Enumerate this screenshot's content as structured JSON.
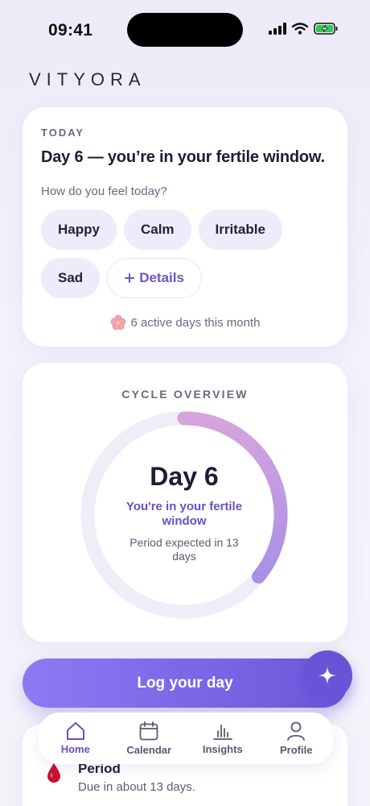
{
  "status_bar": {
    "time": "09:41"
  },
  "brand": "VITYORA",
  "today": {
    "eyebrow": "TODAY",
    "headline": "Day 6 — you’re in your fertile window.",
    "prompt": "How do you feel today?",
    "moods": [
      "Happy",
      "Calm",
      "Irritable",
      "Sad"
    ],
    "details_label": "Details",
    "active_days": "6 active days this month"
  },
  "cycle": {
    "title": "CYCLE OVERVIEW",
    "day": "Day 6",
    "status": "You're in your fertile window",
    "expected": "Period expected in 13 days",
    "progress_fraction": 0.36
  },
  "log_button": "Log your day",
  "period": {
    "title": "Period",
    "subtitle": "Due in about 13 days."
  },
  "tabs": [
    {
      "label": "Home",
      "icon": "home-icon",
      "active": true
    },
    {
      "label": "Calendar",
      "icon": "calendar-icon",
      "active": false
    },
    {
      "label": "Insights",
      "icon": "chart-icon",
      "active": false
    },
    {
      "label": "Profile",
      "icon": "profile-icon",
      "active": false
    }
  ],
  "colors": {
    "accent": "#6A4FC4",
    "button_gradient_start": "#8C7BF2",
    "button_gradient_end": "#6E57D9",
    "ring_gradient_start": "#D6A4DE",
    "ring_gradient_end": "#A890E6",
    "chip_bg": "#EFEBFA",
    "period_drop": "#C8102E"
  }
}
